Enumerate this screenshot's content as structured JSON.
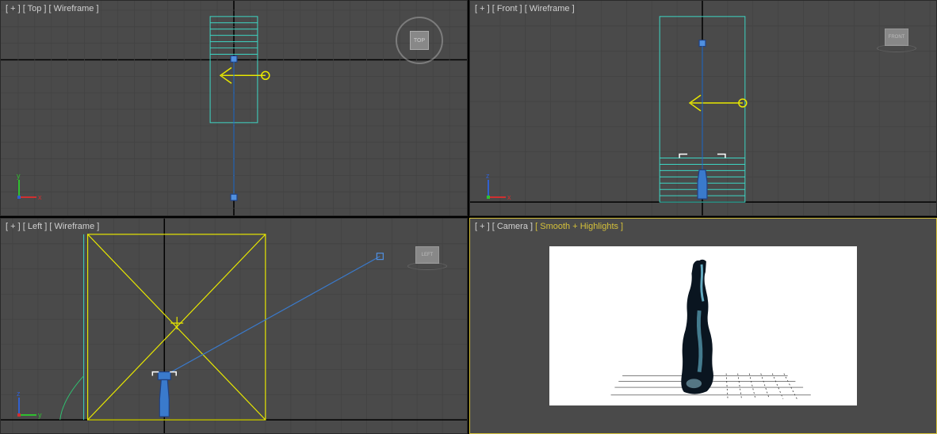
{
  "viewports": {
    "top": {
      "label_plus": "[ + ]",
      "label_name": "[ Top ]",
      "label_mode": "[ Wireframe ]",
      "cube_label": "TOP",
      "axis1": "y",
      "axis2": "x"
    },
    "front": {
      "label_plus": "[ + ]",
      "label_name": "[ Front ]",
      "label_mode": "[ Wireframe ]",
      "cube_label": "FRONT",
      "axis1": "z",
      "axis2": "x"
    },
    "left": {
      "label_plus": "[ + ]",
      "label_name": "[ Left ]",
      "label_mode": "[ Wireframe ]",
      "cube_label": "LEFT",
      "axis1": "z",
      "axis2": "y"
    },
    "camera": {
      "label_plus": "[ + ]",
      "label_name": "[ Camera ]",
      "label_mode": "[ Smooth + Highlights ]"
    }
  },
  "colors": {
    "grid_major": "#3a3a3a",
    "grid_minor": "#424242",
    "axis_black": "#000",
    "wireframe_cyan": "#3dd6c4",
    "wireframe_yellow": "#e8e800",
    "wireframe_blue": "#3a7acc",
    "gizmo_red": "#d03030",
    "gizmo_green": "#30c030",
    "gizmo_blue": "#3060d0",
    "highlight_text": "#d4c03a"
  }
}
